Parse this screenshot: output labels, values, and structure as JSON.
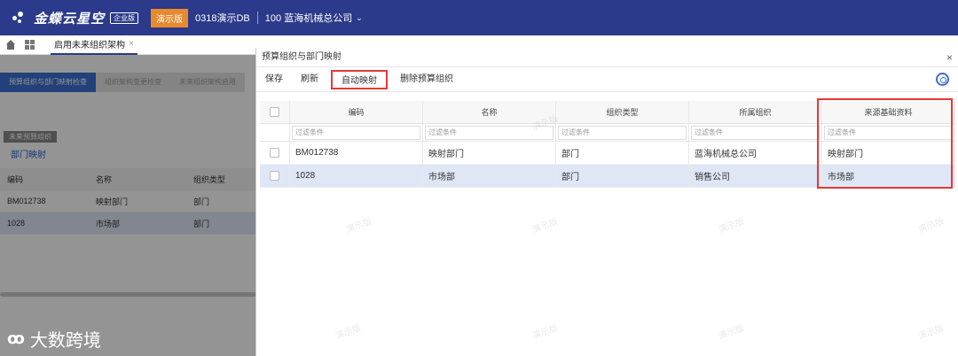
{
  "topbar": {
    "logo_text": "金蝶云星空",
    "logo_tag": "企业版",
    "env_badge": "演示版",
    "db_name": "0318演示DB",
    "org_name": "100 蓝海机械总公司"
  },
  "tabs": {
    "active": "启用未来组织架构"
  },
  "background": {
    "steps": [
      "预算组织与部门映射检查",
      "组织架构变更检查",
      "未来组织架构启用"
    ],
    "section_tag": "未来预算组织",
    "link": "部门映射",
    "headers": [
      "编码",
      "名称",
      "组织类型"
    ],
    "rows": [
      [
        "BM012738",
        "映射部门",
        "部门"
      ],
      [
        "1028",
        "市场部",
        "部门"
      ]
    ],
    "watermark": "大数跨境"
  },
  "dialog": {
    "title": "预算组织与部门映射",
    "toolbar": {
      "save": "保存",
      "refresh": "刷新",
      "auto_map": "自动映射",
      "delete_org": "删除预算组织"
    },
    "grid": {
      "headers": [
        "编码",
        "名称",
        "组织类型",
        "所属组织",
        "来源基础资料"
      ],
      "filter_placeholder": "过滤条件",
      "rows": [
        [
          "BM012738",
          "映射部门",
          "部门",
          "蓝海机械总公司",
          "映射部门"
        ],
        [
          "1028",
          "市场部",
          "部门",
          "销售公司",
          "市场部"
        ]
      ]
    },
    "watermark_text": "演示版"
  }
}
